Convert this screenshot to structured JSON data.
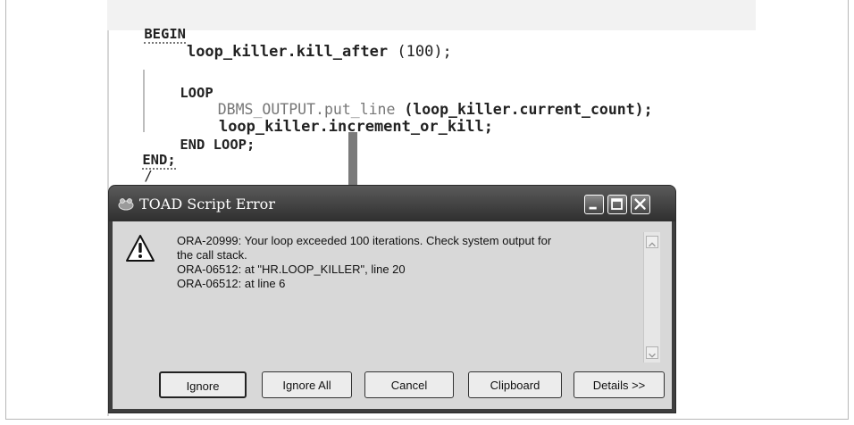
{
  "code": {
    "begin": "BEGIN",
    "line1_call": "loop_killer.kill_after",
    "line1_arg": "(100);",
    "loop": "LOOP",
    "line3_fn": "DBMS_OUTPUT.put_line",
    "line3_arg": "(loop_killer.current_count);",
    "line4": "loop_killer.increment_or_kill;",
    "end_loop": "END LOOP;",
    "end": "END;",
    "slash": "/"
  },
  "dialog": {
    "title": "TOAD Script Error",
    "message_lines": [
      "ORA-20999: Your loop exceeded 100 iterations. Check system output for",
      "the call stack.",
      "ORA-06512: at \"HR.LOOP_KILLER\", line 20",
      "ORA-06512: at line 6"
    ],
    "buttons": {
      "ignore": "Ignore",
      "ignore_all": "Ignore All",
      "cancel": "Cancel",
      "clipboard": "Clipboard",
      "details": "Details >>"
    }
  },
  "icons": {
    "title": "toad-app-icon",
    "minimize": "minimize-icon",
    "maximize": "maximize-icon",
    "close": "close-icon",
    "warning": "warning-icon",
    "arrow": "down-arrow-pointer"
  }
}
